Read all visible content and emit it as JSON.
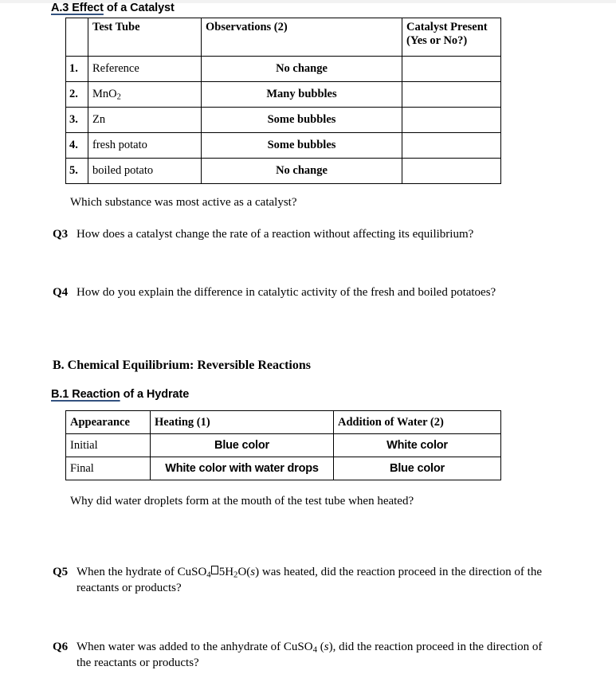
{
  "document": {
    "sections": {
      "a3": {
        "label_underlined": "A.3  Effect",
        "label_rest": " of a Catalyst"
      },
      "b": {
        "heading": "B.  Chemical Equilibrium: Reversible Reactions"
      },
      "b1": {
        "label_underlined": "B.1  Reaction",
        "label_rest": " of a Hydrate"
      }
    },
    "table_a3": {
      "headers": {
        "number": "",
        "test_tube": "Test Tube",
        "observations": "Observations (2)",
        "catalyst_present_line1": "Catalyst Present",
        "catalyst_present_line2": "(Yes or No?)"
      },
      "rows": [
        {
          "number": "1.",
          "test_tube": "Reference",
          "observations": "No change",
          "catalyst_present": ""
        },
        {
          "number": "2.",
          "test_tube_prefix": "MnO",
          "test_tube_sub": "2",
          "observations": "Many bubbles",
          "catalyst_present": ""
        },
        {
          "number": "3.",
          "test_tube": "Zn",
          "observations": "Some bubbles",
          "catalyst_present": ""
        },
        {
          "number": "4.",
          "test_tube": "fresh potato",
          "observations": "Some bubbles",
          "catalyst_present": ""
        },
        {
          "number": "5.",
          "test_tube": "boiled potato",
          "observations": "No change",
          "catalyst_present": ""
        }
      ]
    },
    "table_b1": {
      "headers": {
        "appearance": "Appearance",
        "heating": "Heating (1)",
        "addition_of_water": "Addition of Water (2)"
      },
      "rows": [
        {
          "appearance": "Initial",
          "heating": "Blue color",
          "addition_of_water": "White color"
        },
        {
          "appearance": "Final",
          "heating": "White color with water drops",
          "addition_of_water": "Blue color"
        }
      ]
    },
    "prompts": {
      "which_substance": "Which substance was most active as a catalyst?",
      "why_droplets": "Why did water droplets form at the mouth of the test tube when heated?"
    },
    "questions": {
      "q3": {
        "label": "Q3",
        "text": "How does a catalyst change the rate of a reaction without affecting its equilibrium?"
      },
      "q4": {
        "label": "Q4",
        "text": "How do you explain the difference in catalytic activity of the fresh and boiled potatoes?"
      },
      "q5": {
        "label": "Q5",
        "part1": "When the hydrate of  CuSO",
        "sub1": "4",
        "part2": "5H",
        "sub2": "2",
        "part3": "O(",
        "italic1": "s",
        "part4": ")  was heated, did the reaction proceed in the direction of the reactants or products?"
      },
      "q6": {
        "label": "Q6",
        "part1": "When water was added to the anhydrate of  CuSO",
        "sub1": "4",
        "part2": " (",
        "italic1": "s",
        "part3": "),  did the reaction proceed in the direction of the reactants or products?"
      }
    }
  },
  "colors": {
    "underline": "#33527f",
    "text": "#000000",
    "border": "#000000",
    "page_background": "#ffffff"
  }
}
